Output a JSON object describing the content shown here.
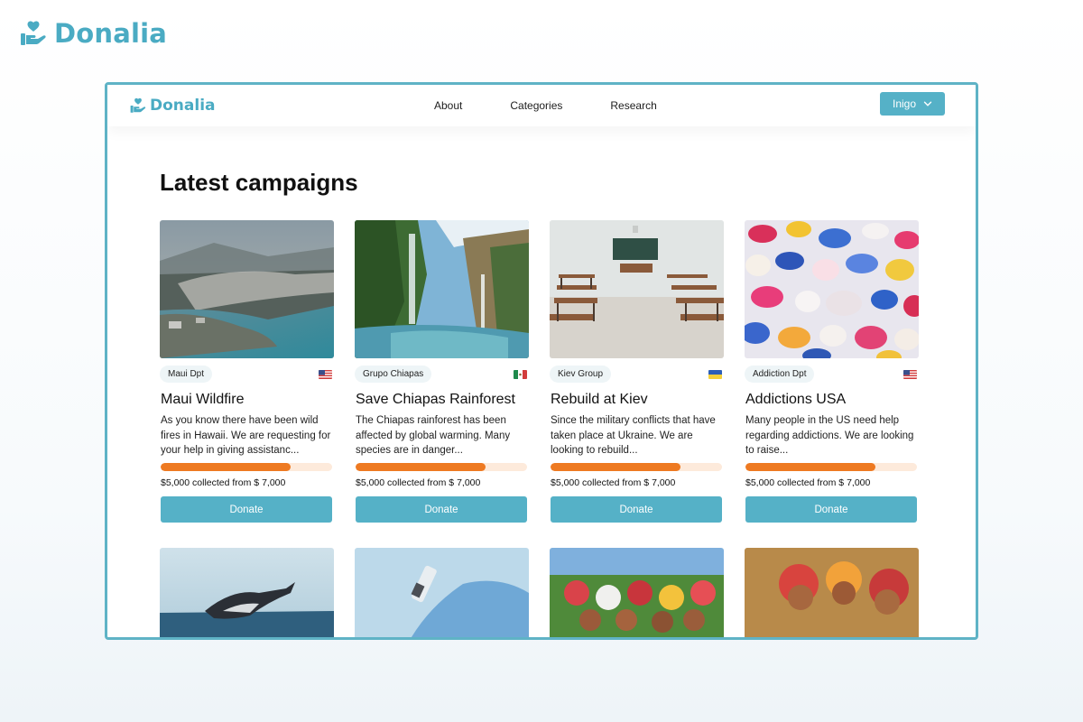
{
  "brand": {
    "name": "Donalia",
    "color": "#4aabc3"
  },
  "nav": {
    "links": [
      "About",
      "Categories",
      "Research"
    ],
    "user_label": "Inigo"
  },
  "page_title": "Latest campaigns",
  "campaigns": [
    {
      "org": "Maui Dpt",
      "flag": "us",
      "title": "Maui Wildfire",
      "description": "As you know there have been wild fires in Hawaii. We are requesting for your help in giving assistanc...",
      "progress": 0.75,
      "collected": "$5,000 collected from $ 7,000",
      "button": "Donate"
    },
    {
      "org": "Grupo Chiapas",
      "flag": "mx",
      "title": "Save Chiapas Rainforest",
      "description": "The Chiapas rainforest has been affected by global warming. Many species are in danger...",
      "progress": 0.75,
      "collected": "$5,000 collected from $ 7,000",
      "button": "Donate"
    },
    {
      "org": "Kiev Group",
      "flag": "ua",
      "title": "Rebuild at Kiev",
      "description": "Since the military conflicts that have taken place at Ukraine. We are looking to rebuild...",
      "progress": 0.75,
      "collected": "$5,000 collected from $ 7,000",
      "button": "Donate"
    },
    {
      "org": "Addiction Dpt",
      "flag": "us",
      "title": "Addictions USA",
      "description": "Many people in the US need help regarding addictions. We are looking to raise...",
      "progress": 0.75,
      "collected": "$5,000 collected from $ 7,000",
      "button": "Donate"
    }
  ],
  "colors": {
    "accent": "#55b1c7",
    "window_border": "#5fb3c6",
    "progress_fill": "#ee7a22",
    "progress_track": "#fdeadb",
    "badge_bg": "#eef5f7"
  }
}
